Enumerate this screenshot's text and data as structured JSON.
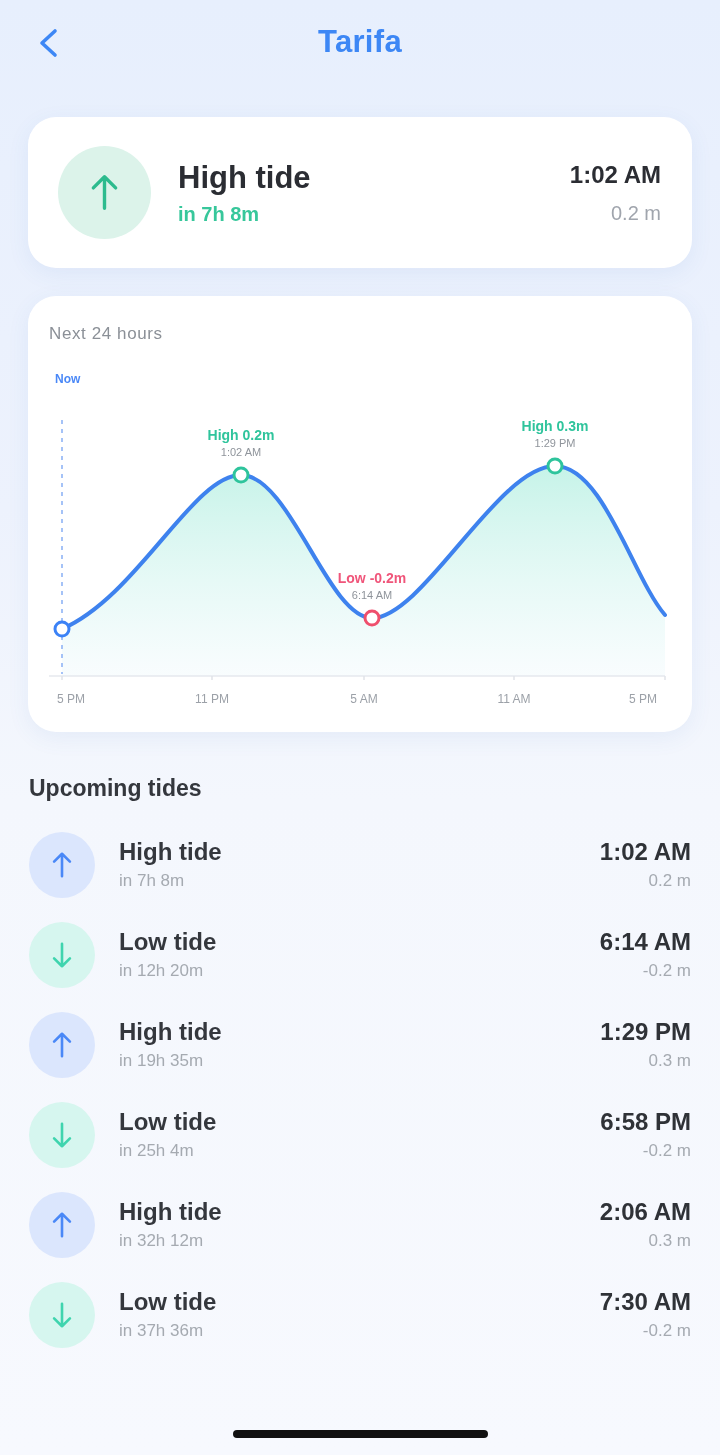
{
  "header": {
    "title": "Tarifa"
  },
  "next_tide": {
    "kind": "high",
    "title": "High tide",
    "countdown": "in 7h 8m",
    "time": "1:02 AM",
    "height": "0.2 m"
  },
  "chart": {
    "title": "Next 24 hours",
    "markers": [
      {
        "kind": "now",
        "label": "Now"
      },
      {
        "kind": "high",
        "label": "High 0.2m",
        "time": "1:02 AM"
      },
      {
        "kind": "low",
        "label": "Low -0.2m",
        "time": "6:14 AM"
      },
      {
        "kind": "high",
        "label": "High 0.3m",
        "time": "1:29 PM"
      }
    ],
    "x_labels": [
      "5 PM",
      "11 PM",
      "5 AM",
      "11 AM",
      "5 PM"
    ]
  },
  "upcoming": {
    "title": "Upcoming tides",
    "tides": [
      {
        "kind": "high",
        "title": "High tide",
        "countdown": "in 7h 8m",
        "time": "1:02 AM",
        "height": "0.2 m"
      },
      {
        "kind": "low",
        "title": "Low tide",
        "countdown": "in 12h 20m",
        "time": "6:14 AM",
        "height": "-0.2 m"
      },
      {
        "kind": "high",
        "title": "High tide",
        "countdown": "in 19h 35m",
        "time": "1:29 PM",
        "height": "0.3 m"
      },
      {
        "kind": "low",
        "title": "Low tide",
        "countdown": "in 25h 4m",
        "time": "6:58 PM",
        "height": "-0.2 m"
      },
      {
        "kind": "high",
        "title": "High tide",
        "countdown": "in 32h 12m",
        "time": "2:06 AM",
        "height": "0.3 m"
      },
      {
        "kind": "low",
        "title": "Low tide",
        "countdown": "in 37h 36m",
        "time": "7:30 AM",
        "height": "-0.2 m"
      }
    ]
  }
}
